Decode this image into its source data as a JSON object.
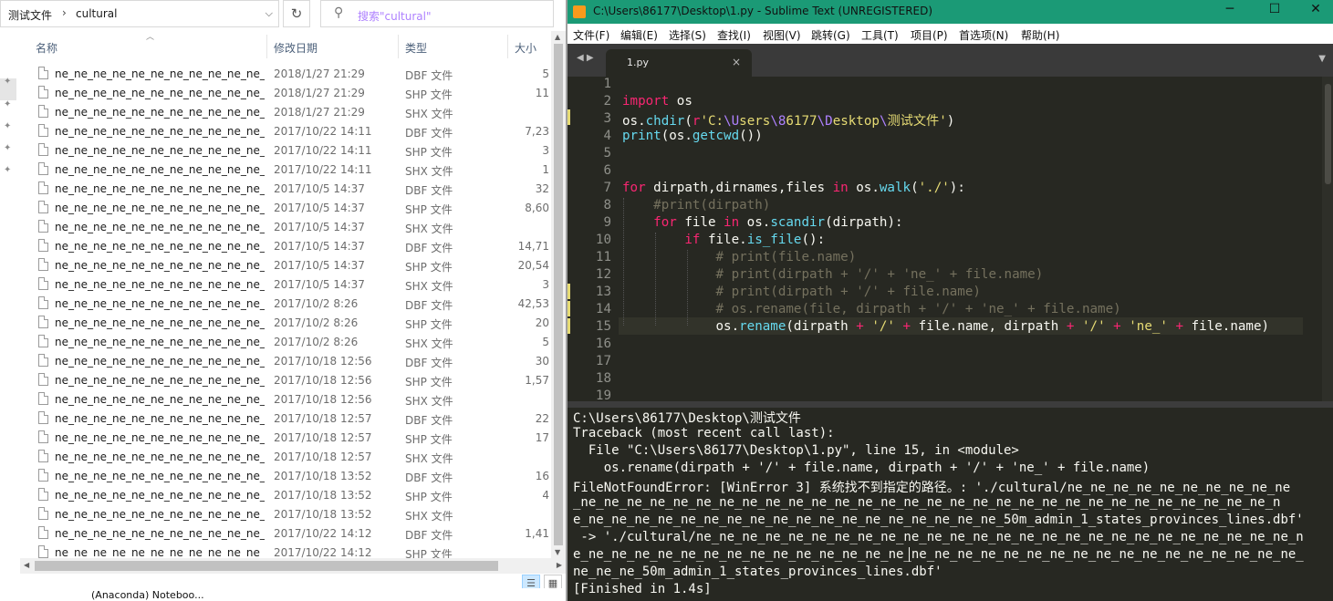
{
  "explorer": {
    "breadcrumb": {
      "parent": "测试文件",
      "separator": "›",
      "current": "cultural"
    },
    "search_placeholder": "搜索\"cultural\"",
    "columns": {
      "name": "名称",
      "date": "修改日期",
      "type": "类型",
      "size": "大小"
    },
    "rows": [
      {
        "name": "ne_ne_ne_ne_ne_ne_ne_ne_ne_ne_ne_ne_n...",
        "date": "2018/1/27 21:29",
        "type": "DBF 文件",
        "size": "5"
      },
      {
        "name": "ne_ne_ne_ne_ne_ne_ne_ne_ne_ne_ne_ne_n...",
        "date": "2018/1/27 21:29",
        "type": "SHP 文件",
        "size": "11"
      },
      {
        "name": "ne_ne_ne_ne_ne_ne_ne_ne_ne_ne_ne_ne_n...",
        "date": "2018/1/27 21:29",
        "type": "SHX 文件",
        "size": ""
      },
      {
        "name": "ne_ne_ne_ne_ne_ne_ne_ne_ne_ne_ne_ne_n...",
        "date": "2017/10/22 14:11",
        "type": "DBF 文件",
        "size": "7,23"
      },
      {
        "name": "ne_ne_ne_ne_ne_ne_ne_ne_ne_ne_ne_ne_n...",
        "date": "2017/10/22 14:11",
        "type": "SHP 文件",
        "size": "3"
      },
      {
        "name": "ne_ne_ne_ne_ne_ne_ne_ne_ne_ne_ne_ne_n...",
        "date": "2017/10/22 14:11",
        "type": "SHX 文件",
        "size": "1"
      },
      {
        "name": "ne_ne_ne_ne_ne_ne_ne_ne_ne_ne_ne_ne_n...",
        "date": "2017/10/5 14:37",
        "type": "DBF 文件",
        "size": "32"
      },
      {
        "name": "ne_ne_ne_ne_ne_ne_ne_ne_ne_ne_ne_ne_n...",
        "date": "2017/10/5 14:37",
        "type": "SHP 文件",
        "size": "8,60"
      },
      {
        "name": "ne_ne_ne_ne_ne_ne_ne_ne_ne_ne_ne_ne_n...",
        "date": "2017/10/5 14:37",
        "type": "SHX 文件",
        "size": ""
      },
      {
        "name": "ne_ne_ne_ne_ne_ne_ne_ne_ne_ne_ne_ne_n...",
        "date": "2017/10/5 14:37",
        "type": "DBF 文件",
        "size": "14,71"
      },
      {
        "name": "ne_ne_ne_ne_ne_ne_ne_ne_ne_ne_ne_ne_n...",
        "date": "2017/10/5 14:37",
        "type": "SHP 文件",
        "size": "20,54"
      },
      {
        "name": "ne_ne_ne_ne_ne_ne_ne_ne_ne_ne_ne_ne_n...",
        "date": "2017/10/5 14:37",
        "type": "SHX 文件",
        "size": "3"
      },
      {
        "name": "ne_ne_ne_ne_ne_ne_ne_ne_ne_ne_ne_ne_n...",
        "date": "2017/10/2 8:26",
        "type": "DBF 文件",
        "size": "42,53"
      },
      {
        "name": "ne_ne_ne_ne_ne_ne_ne_ne_ne_ne_ne_ne_n...",
        "date": "2017/10/2 8:26",
        "type": "SHP 文件",
        "size": "20"
      },
      {
        "name": "ne_ne_ne_ne_ne_ne_ne_ne_ne_ne_ne_ne_n...",
        "date": "2017/10/2 8:26",
        "type": "SHX 文件",
        "size": "5"
      },
      {
        "name": "ne_ne_ne_ne_ne_ne_ne_ne_ne_ne_ne_ne_n...",
        "date": "2017/10/18 12:56",
        "type": "DBF 文件",
        "size": "30"
      },
      {
        "name": "ne_ne_ne_ne_ne_ne_ne_ne_ne_ne_ne_ne_n...",
        "date": "2017/10/18 12:56",
        "type": "SHP 文件",
        "size": "1,57"
      },
      {
        "name": "ne_ne_ne_ne_ne_ne_ne_ne_ne_ne_ne_ne_n...",
        "date": "2017/10/18 12:56",
        "type": "SHX 文件",
        "size": ""
      },
      {
        "name": "ne_ne_ne_ne_ne_ne_ne_ne_ne_ne_ne_ne_n...",
        "date": "2017/10/18 12:57",
        "type": "DBF 文件",
        "size": "22"
      },
      {
        "name": "ne_ne_ne_ne_ne_ne_ne_ne_ne_ne_ne_ne_n...",
        "date": "2017/10/18 12:57",
        "type": "SHP 文件",
        "size": "17"
      },
      {
        "name": "ne_ne_ne_ne_ne_ne_ne_ne_ne_ne_ne_ne_n...",
        "date": "2017/10/18 12:57",
        "type": "SHX 文件",
        "size": ""
      },
      {
        "name": "ne_ne_ne_ne_ne_ne_ne_ne_ne_ne_ne_ne_n...",
        "date": "2017/10/18 13:52",
        "type": "DBF 文件",
        "size": "16"
      },
      {
        "name": "ne_ne_ne_ne_ne_ne_ne_ne_ne_ne_ne_ne_n...",
        "date": "2017/10/18 13:52",
        "type": "SHP 文件",
        "size": "4"
      },
      {
        "name": "ne_ne_ne_ne_ne_ne_ne_ne_ne_ne_ne_ne_n...",
        "date": "2017/10/18 13:52",
        "type": "SHX 文件",
        "size": ""
      },
      {
        "name": "ne_ne_ne_ne_ne_ne_ne_ne_ne_ne_ne_ne_n...",
        "date": "2017/10/22 14:12",
        "type": "DBF 文件",
        "size": "1,41"
      },
      {
        "name": "ne_ne_ne_ne_ne_ne_ne_ne_ne_ne_ne_ne_n...",
        "date": "2017/10/22 14:12",
        "type": "SHP 文件",
        "size": ""
      }
    ],
    "taskbar_text": "(Anaconda)   Noteboo..."
  },
  "sublime": {
    "title": "C:\\Users\\86177\\Desktop\\1.py - Sublime Text (UNREGISTERED)",
    "menu": [
      "文件(F)",
      "编辑(E)",
      "选择(S)",
      "查找(I)",
      "视图(V)",
      "跳转(G)",
      "工具(T)",
      "项目(P)",
      "首选项(N)",
      "帮助(H)"
    ],
    "tab_label": "1.py",
    "line_numbers": [
      "1",
      "2",
      "3",
      "4",
      "5",
      "6",
      "7",
      "8",
      "9",
      "10",
      "11",
      "12",
      "13",
      "14",
      "15",
      "16",
      "17",
      "18",
      "19"
    ],
    "output": [
      "C:\\Users\\86177\\Desktop\\测试文件",
      "Traceback (most recent call last):",
      "  File \"C:\\Users\\86177\\Desktop\\1.py\", line 15, in <module>",
      "    os.rename(dirpath + '/' + file.name, dirpath + '/' + 'ne_' + file.name)",
      "FileNotFoundError: [WinError 3] 系统找不到指定的路径。: './cultural/ne_ne_ne_ne_ne_ne_ne_ne_ne_ne",
      "_ne_ne_ne_ne_ne_ne_ne_ne_ne_ne_ne_ne_ne_ne_ne_ne_ne_ne_ne_ne_ne_ne_ne_ne_ne_ne_ne_ne_ne_ne_n",
      "e_ne_ne_ne_ne_ne_ne_ne_ne_ne_ne_ne_ne_ne_ne_ne_ne_ne_ne_50m_admin_1_states_provinces_lines.dbf'",
      " -> './cultural/ne_ne_ne_ne_ne_ne_ne_ne_ne_ne_ne_ne_ne_ne_ne_ne_ne_ne_ne_ne_ne_ne_ne_ne_ne_ne_n",
      "e_ne_ne_ne_ne_ne_ne_ne_ne_ne_ne_ne_ne_ne_ne_ne_ne_ne_ne_ne_ne_ne_ne_ne_ne_ne_ne_ne_ne_ne_ne_ne_",
      "ne_ne_ne_50m_admin_1_states_provinces_lines.dbf'",
      "[Finished in 1.4s]"
    ]
  }
}
